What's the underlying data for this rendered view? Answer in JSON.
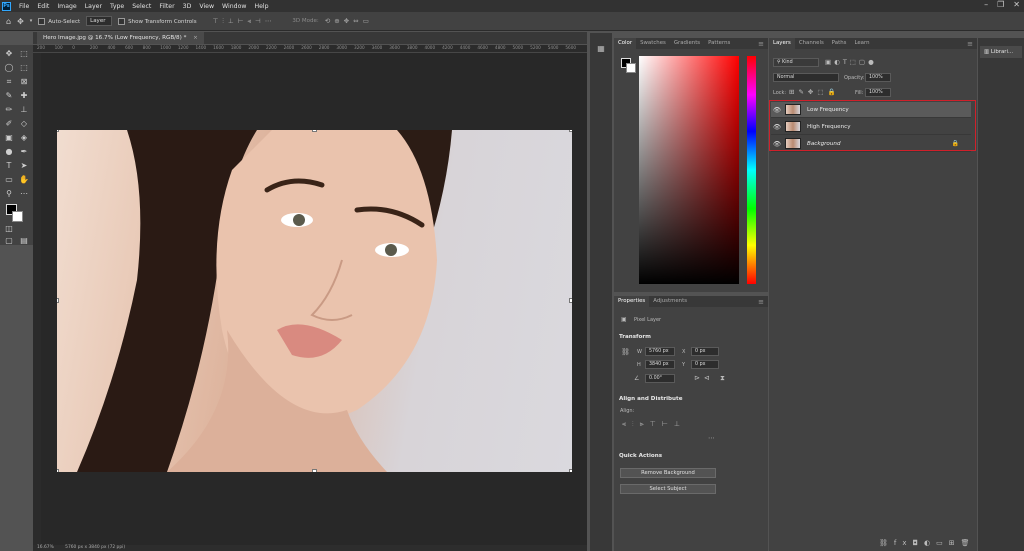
{
  "menubar": {
    "logo": "Ps",
    "items": [
      "File",
      "Edit",
      "Image",
      "Layer",
      "Type",
      "Select",
      "Filter",
      "3D",
      "View",
      "Window",
      "Help"
    ]
  },
  "options": {
    "auto_select_label": "Auto-Select",
    "auto_select_target": "Layer",
    "show_transform_label": "Show Transform Controls",
    "mode_3d_label": "3D Mode:"
  },
  "document": {
    "tab_title": "Hero Image.jpg @ 16.7% (Low Frequency, RGB/8) *",
    "ruler_ticks": [
      "200",
      "100",
      "0",
      "200",
      "400",
      "600",
      "800",
      "1000",
      "1200",
      "1400",
      "1600",
      "1800",
      "2000",
      "2200",
      "2400",
      "2600",
      "2800",
      "3000",
      "3200",
      "3400",
      "3600",
      "3800",
      "4000",
      "4200",
      "4400",
      "4600",
      "4800",
      "5000",
      "5200",
      "5400",
      "5600"
    ],
    "zoom": "16.67%",
    "doc_size": "5760 px x 3840 px (72 ppi)"
  },
  "color_panel": {
    "tabs": [
      "Color",
      "Swatches",
      "Gradients",
      "Patterns"
    ],
    "active_tab": "Color",
    "foreground": "#000000",
    "background": "#ffffff"
  },
  "properties_panel": {
    "tabs": [
      "Properties",
      "Adjustments"
    ],
    "layer_type": "Pixel Layer",
    "transform": {
      "title": "Transform",
      "w_label": "W",
      "w": "5760 px",
      "h_label": "H",
      "h": "3840 px",
      "x_label": "X",
      "x": "0 px",
      "y_label": "Y",
      "y": "0 px",
      "angle": "0.00°"
    },
    "align": {
      "title": "Align and Distribute",
      "subtitle": "Align:"
    },
    "quick_actions": {
      "title": "Quick Actions",
      "buttons": [
        "Remove Background",
        "Select Subject"
      ]
    }
  },
  "layers_panel": {
    "tabs": [
      "Layers",
      "Channels",
      "Paths",
      "Learn"
    ],
    "active_tab": "Layers",
    "filter": "Kind",
    "blend_mode": "Normal",
    "opacity_label": "Opacity:",
    "opacity": "100%",
    "lock_label": "Lock:",
    "fill_label": "Fill:",
    "fill": "100%",
    "layers": [
      {
        "name": "Low Frequency",
        "selected": true,
        "locked": false
      },
      {
        "name": "High Frequency",
        "selected": false,
        "locked": false
      },
      {
        "name": "Background",
        "selected": false,
        "locked": true
      }
    ],
    "highlight_color": "#d0202a"
  },
  "libraries_panel": {
    "tab": "Librari..."
  }
}
